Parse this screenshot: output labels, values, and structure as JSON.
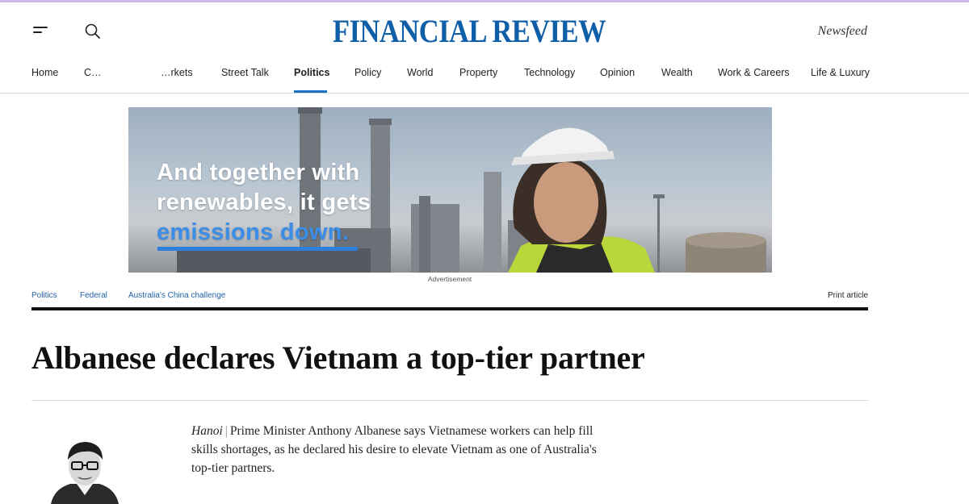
{
  "brand": {
    "logo_text": "FINANCIAL REVIEW",
    "newsfeed_label": "Newsfeed",
    "accent_color": "#0f5ea8"
  },
  "nav": {
    "items": [
      {
        "label": "Home"
      },
      {
        "label": "C…"
      },
      {
        "label": "…rkets"
      },
      {
        "label": "Street Talk"
      },
      {
        "label": "Politics",
        "active": true
      },
      {
        "label": "Policy"
      },
      {
        "label": "World"
      },
      {
        "label": "Property"
      },
      {
        "label": "Technology"
      },
      {
        "label": "Opinion"
      },
      {
        "label": "Wealth"
      },
      {
        "label": "Work & Careers"
      },
      {
        "label": "Life & Luxury"
      }
    ]
  },
  "ad": {
    "line1": "And together with",
    "line2": "renewables, it gets",
    "line3": "emissions down.",
    "label": "Advertisement",
    "highlight_color": "#3b8ee8"
  },
  "breadcrumbs": {
    "items": [
      {
        "label": "Politics"
      },
      {
        "label": "Federal"
      },
      {
        "label": "Australia's China challenge"
      }
    ],
    "print_label": "Print article"
  },
  "article": {
    "title": "Albanese declares Vietnam a top-tier partner",
    "dateline": "Hanoi",
    "separator": "|",
    "lead": "Prime Minister Anthony Albanese says Vietnamese workers can help fill skills shortages, as he declared his desire to elevate Vietnam as one of Australia's top-tier partners."
  },
  "icons": {
    "menu": "hamburger-menu-icon",
    "search": "search-icon"
  }
}
